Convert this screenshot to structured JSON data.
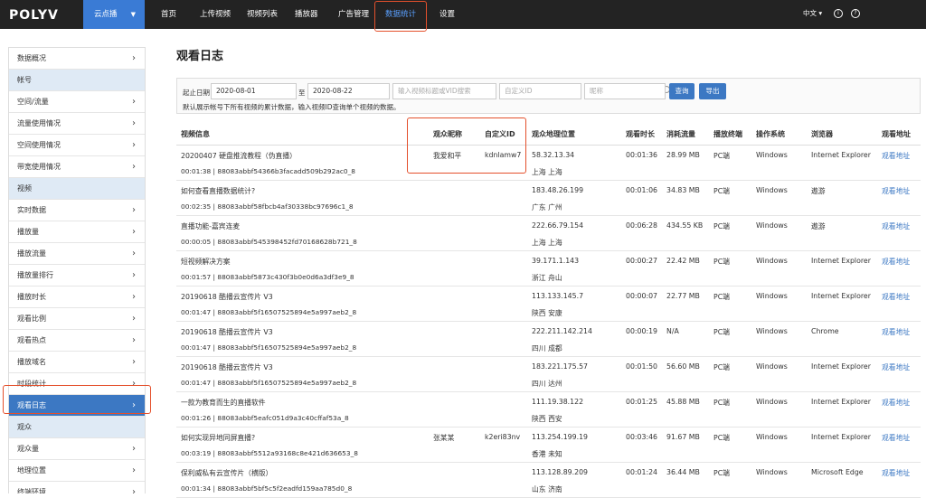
{
  "topbar": {
    "logo": "POLYV",
    "product": "云点播",
    "nav": [
      "首页",
      "上传视频",
      "视频列表",
      "播放器",
      "广告管理",
      "数据统计",
      "设置"
    ],
    "lang": "中文",
    "lang_chevron": "▾"
  },
  "sidebar": {
    "items": [
      {
        "type": "item",
        "label": "数据概况"
      },
      {
        "type": "section",
        "label": "帐号"
      },
      {
        "type": "item",
        "label": "空间/流量"
      },
      {
        "type": "item",
        "label": "流量使用情况"
      },
      {
        "type": "item",
        "label": "空间使用情况"
      },
      {
        "type": "item",
        "label": "带宽使用情况"
      },
      {
        "type": "section",
        "label": "视频"
      },
      {
        "type": "item",
        "label": "实时数据"
      },
      {
        "type": "item",
        "label": "播放量"
      },
      {
        "type": "item",
        "label": "播放流量"
      },
      {
        "type": "item",
        "label": "播放量排行"
      },
      {
        "type": "item",
        "label": "播放时长"
      },
      {
        "type": "item",
        "label": "观看比例"
      },
      {
        "type": "item",
        "label": "观看热点"
      },
      {
        "type": "item",
        "label": "播放域名"
      },
      {
        "type": "item",
        "label": "时段统计"
      },
      {
        "type": "item",
        "label": "观看日志",
        "active": true
      },
      {
        "type": "section",
        "label": "观众"
      },
      {
        "type": "item",
        "label": "观众量"
      },
      {
        "type": "item",
        "label": "地理位置"
      },
      {
        "type": "item",
        "label": "终端环境"
      }
    ]
  },
  "page": {
    "title": "观看日志"
  },
  "filter": {
    "date_label": "起止日期",
    "start_date": "2020-08-01",
    "to_label": "至",
    "end_date": "2020-08-22",
    "search_placeholder": "输入视频标题或VID搜索",
    "custom_id_placeholder": "自定义ID",
    "nickname_placeholder": "昵称",
    "query_label": "查询",
    "export_label": "导出",
    "note": "默认展示帐号下所有视频的累计数据，输入视频ID查询单个视频的数据。"
  },
  "table": {
    "headers": [
      "视频信息",
      "观众昵称",
      "自定义ID",
      "观众地理位置",
      "观看时长",
      "消耗流量",
      "播放终端",
      "操作系统",
      "浏览器",
      "观看地址"
    ],
    "rows": [
      {
        "title": "20200407 硬盘推流教程（伪直播）",
        "meta": "00:01:38 | 88083abbf54366b3facadd509b292ac0_8",
        "nick": "我爱和平",
        "cid": "kdnlamw7",
        "ip": "58.32.13.34",
        "loc": "上海 上海",
        "dur": "00:01:36",
        "flow": "28.99 MB",
        "term": "PC端",
        "os": "Windows",
        "browser": "Internet Explorer",
        "url": "观看地址"
      },
      {
        "title": "如何查看直播数据统计?",
        "meta": "00:02:35 | 88083abbf58fbcb4af30338bc97696c1_8",
        "nick": "",
        "cid": "",
        "ip": "183.48.26.199",
        "loc": "广东 广州",
        "dur": "00:01:06",
        "flow": "34.83 MB",
        "term": "PC端",
        "os": "Windows",
        "browser": "遨游",
        "url": "观看地址"
      },
      {
        "title": "直播功能-嘉宾连麦",
        "meta": "00:00:05 | 88083abbf545398452fd70168628b721_8",
        "nick": "",
        "cid": "",
        "ip": "222.66.79.154",
        "loc": "上海 上海",
        "dur": "00:06:28",
        "flow": "434.55 KB",
        "term": "PC端",
        "os": "Windows",
        "browser": "遨游",
        "url": "观看地址"
      },
      {
        "title": "短视频解决方案",
        "meta": "00:01:57 | 88083abbf5873c430f3b0e0d6a3df3e9_8",
        "nick": "",
        "cid": "",
        "ip": "39.171.1.143",
        "loc": "浙江 舟山",
        "dur": "00:00:27",
        "flow": "22.42 MB",
        "term": "PC端",
        "os": "Windows",
        "browser": "Internet Explorer",
        "url": "观看地址"
      },
      {
        "title": "20190618 酷播云宣传片 V3",
        "meta": "00:01:47 | 88083abbf5f16507525894e5a997aeb2_8",
        "nick": "",
        "cid": "",
        "ip": "113.133.145.7",
        "loc": "陕西 安康",
        "dur": "00:00:07",
        "flow": "22.77 MB",
        "term": "PC端",
        "os": "Windows",
        "browser": "Internet Explorer",
        "url": "观看地址"
      },
      {
        "title": "20190618 酷播云宣传片 V3",
        "meta": "00:01:47 | 88083abbf5f16507525894e5a997aeb2_8",
        "nick": "",
        "cid": "",
        "ip": "222.211.142.214",
        "loc": "四川 成都",
        "dur": "00:00:19",
        "flow": "N/A",
        "term": "PC端",
        "os": "Windows",
        "browser": "Chrome",
        "url": "观看地址"
      },
      {
        "title": "20190618 酷播云宣传片 V3",
        "meta": "00:01:47 | 88083abbf5f16507525894e5a997aeb2_8",
        "nick": "",
        "cid": "",
        "ip": "183.221.175.57",
        "loc": "四川 达州",
        "dur": "00:01:50",
        "flow": "56.60 MB",
        "term": "PC端",
        "os": "Windows",
        "browser": "Internet Explorer",
        "url": "观看地址"
      },
      {
        "title": "一款为教育而生的直播软件",
        "meta": "00:01:26 | 88083abbf5eafc051d9a3c40cffaf53a_8",
        "nick": "",
        "cid": "",
        "ip": "111.19.38.122",
        "loc": "陕西 西安",
        "dur": "00:01:25",
        "flow": "45.88 MB",
        "term": "PC端",
        "os": "Windows",
        "browser": "Internet Explorer",
        "url": "观看地址"
      },
      {
        "title": "如何实现异地同屏直播?",
        "meta": "00:03:19 | 88083abbf5512a93168c8e421d636653_8",
        "nick": "张某某",
        "cid": "k2eri83nv",
        "ip": "113.254.199.19",
        "loc": "香港 未知",
        "dur": "00:03:46",
        "flow": "91.67 MB",
        "term": "PC端",
        "os": "Windows",
        "browser": "Internet Explorer",
        "url": "观看地址"
      },
      {
        "title": "保利威私有云宣传片（横版）",
        "meta": "00:01:34 | 88083abbf5bf5c5f2eadfd159aa785d0_8",
        "nick": "",
        "cid": "",
        "ip": "113.128.89.209",
        "loc": "山东 济南",
        "dur": "00:01:24",
        "flow": "36.44 MB",
        "term": "PC端",
        "os": "Windows",
        "browser": "Microsoft Edge",
        "url": "观看地址"
      }
    ]
  },
  "colors": {
    "accent": "#3c78c3",
    "highlight": "#e4502c",
    "topbar": "#232323"
  }
}
